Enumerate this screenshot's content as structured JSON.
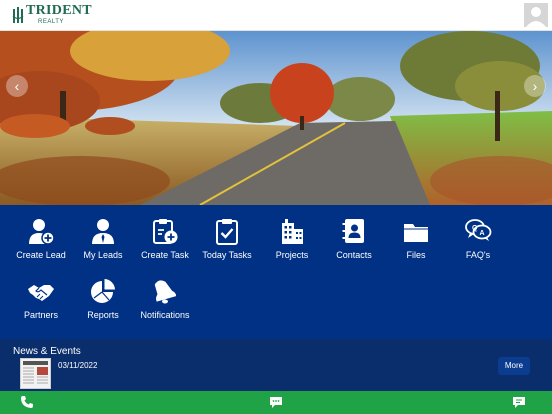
{
  "header": {
    "logo_name": "TRIDENT",
    "logo_sub": "REALTY",
    "avatar_icon": "user-avatar-icon"
  },
  "hero": {
    "prev_label": "‹",
    "next_label": "›"
  },
  "menu": {
    "items": [
      {
        "label": "Create Lead",
        "icon": "create-lead-icon"
      },
      {
        "label": "My Leads",
        "icon": "my-leads-icon"
      },
      {
        "label": "Create Task",
        "icon": "create-task-icon"
      },
      {
        "label": "Today Tasks",
        "icon": "today-tasks-icon"
      },
      {
        "label": "Projects",
        "icon": "projects-icon"
      },
      {
        "label": "Contacts",
        "icon": "contacts-icon"
      },
      {
        "label": "Files",
        "icon": "files-icon"
      },
      {
        "label": "FAQ's",
        "icon": "faq-icon"
      },
      {
        "label": "Partners",
        "icon": "partners-icon"
      },
      {
        "label": "Reports",
        "icon": "reports-icon"
      },
      {
        "label": "Notifications",
        "icon": "notifications-icon"
      }
    ]
  },
  "news": {
    "title": "News & Events",
    "date": "03/11/2022",
    "more_label": "More"
  },
  "bottom_bar": {
    "icons": [
      "phone-icon",
      "sms-icon",
      "chat-icon"
    ]
  },
  "colors": {
    "menu_bg": "#003184",
    "news_bg": "#0a2e6b",
    "bottom_bar": "#1fa346",
    "brand": "#1f6b53"
  }
}
